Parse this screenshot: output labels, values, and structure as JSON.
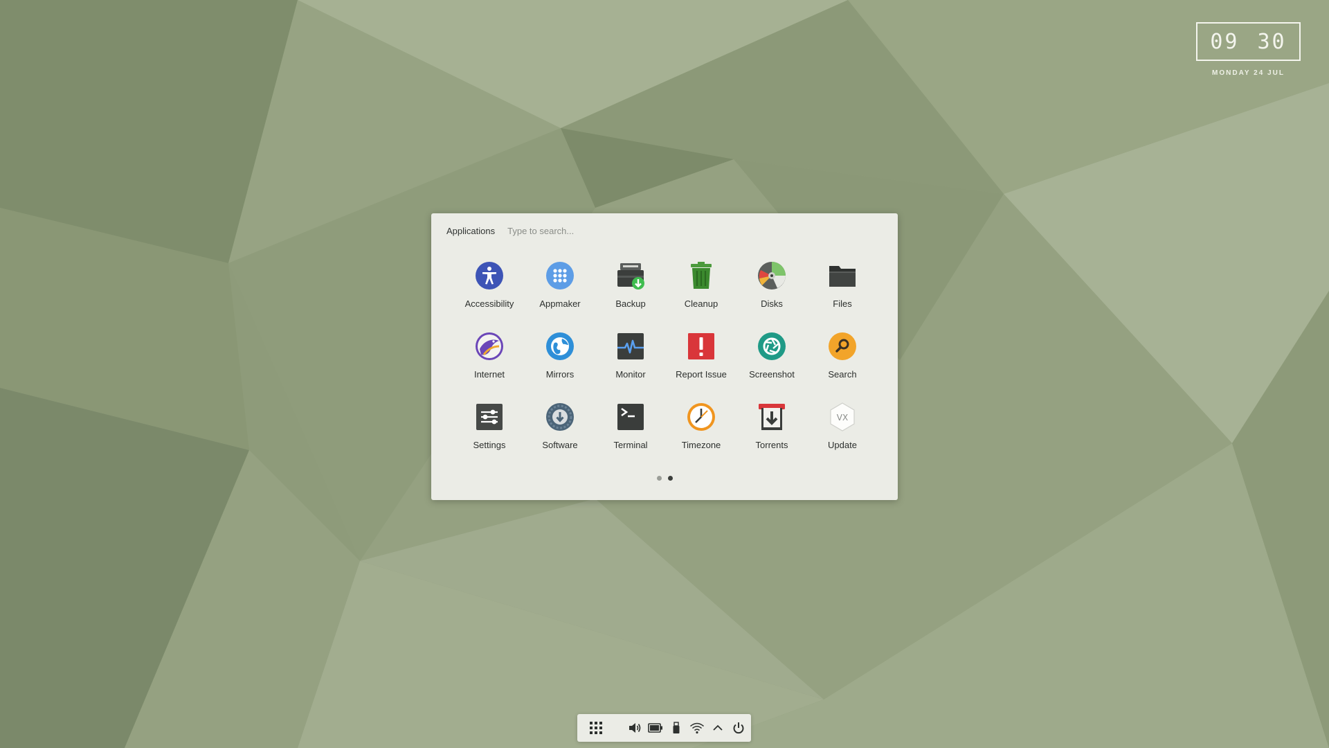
{
  "clock": {
    "hours": "09",
    "minutes": "30",
    "date": "MONDAY 24 JUL"
  },
  "launcher": {
    "title": "Applications",
    "search_placeholder": "Type to search...",
    "apps": [
      {
        "label": "Accessibility",
        "icon": "accessibility-icon"
      },
      {
        "label": "Appmaker",
        "icon": "appmaker-icon"
      },
      {
        "label": "Backup",
        "icon": "backup-icon"
      },
      {
        "label": "Cleanup",
        "icon": "trash-icon"
      },
      {
        "label": "Disks",
        "icon": "disks-icon"
      },
      {
        "label": "Files",
        "icon": "folder-icon"
      },
      {
        "label": "Internet",
        "icon": "browser-icon"
      },
      {
        "label": "Mirrors",
        "icon": "globe-icon"
      },
      {
        "label": "Monitor",
        "icon": "monitor-icon"
      },
      {
        "label": "Report Issue",
        "icon": "report-issue-icon"
      },
      {
        "label": "Screenshot",
        "icon": "camera-shutter-icon"
      },
      {
        "label": "Search",
        "icon": "search-icon"
      },
      {
        "label": "Settings",
        "icon": "settings-sliders-icon"
      },
      {
        "label": "Software",
        "icon": "software-icon"
      },
      {
        "label": "Terminal",
        "icon": "terminal-icon"
      },
      {
        "label": "Timezone",
        "icon": "clock-icon"
      },
      {
        "label": "Torrents",
        "icon": "torrents-icon"
      },
      {
        "label": "Update",
        "icon": "update-icon"
      }
    ],
    "pages": {
      "total": 2,
      "current": 2
    }
  },
  "panel": {
    "items": [
      "app-grid-icon",
      "volume-icon",
      "battery-icon",
      "usb-drive-icon",
      "wifi-icon",
      "chevron-up-icon",
      "power-icon"
    ]
  },
  "colors": {
    "wallpaper": "#8c9a78",
    "launcher_bg": "#ebece6",
    "accent_blue": "#3d54b6"
  }
}
